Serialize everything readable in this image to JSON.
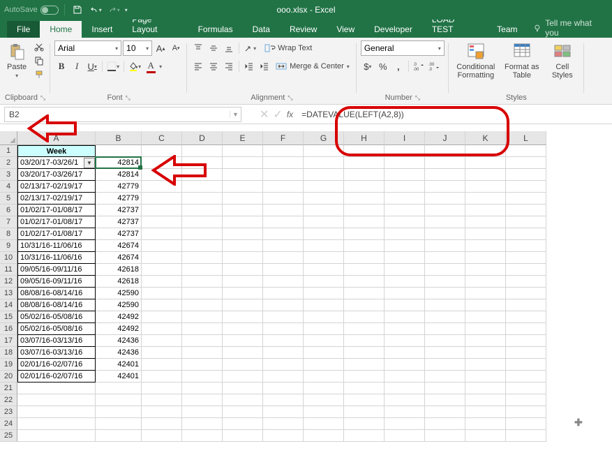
{
  "title": "ooo.xlsx - Excel",
  "autosave_label": "AutoSave",
  "toggle_state": "Off",
  "tabs": {
    "file": "File",
    "home": "Home",
    "insert": "Insert",
    "page_layout": "Page Layout",
    "formulas": "Formulas",
    "data": "Data",
    "review": "Review",
    "view": "View",
    "developer": "Developer",
    "load_test": "LOAD TEST",
    "team": "Team"
  },
  "tellme": "Tell me what you",
  "ribbon": {
    "clipboard": {
      "label": "Clipboard",
      "paste": "Paste"
    },
    "font": {
      "label": "Font",
      "name": "Arial",
      "size": "10",
      "bold": "B",
      "italic": "I",
      "underline": "U",
      "color_letter": "A",
      "size_up": "A",
      "size_down": "A"
    },
    "alignment": {
      "label": "Alignment",
      "wrap": "Wrap Text",
      "merge": "Merge & Center"
    },
    "number": {
      "label": "Number",
      "format": "General",
      "currency": "$",
      "percent": "%",
      "comma": ","
    },
    "styles": {
      "label": "Styles",
      "conditional": "Conditional Formatting",
      "table": "Format as Table",
      "cell_styles": "Cell Styles"
    }
  },
  "namebox": "B2",
  "formula": "=DATEVALUE(LEFT(A2,8))",
  "fx": "fx",
  "col_headers": [
    "A",
    "B",
    "C",
    "D",
    "E",
    "F",
    "G",
    "H",
    "I",
    "J",
    "K",
    "L"
  ],
  "header_cell": "Week",
  "data_rows": [
    {
      "n": "2",
      "a": "03/20/17-03/26/1",
      "b": "42814"
    },
    {
      "n": "3",
      "a": "03/20/17-03/26/17",
      "b": "42814"
    },
    {
      "n": "4",
      "a": "02/13/17-02/19/17",
      "b": "42779"
    },
    {
      "n": "5",
      "a": "02/13/17-02/19/17",
      "b": "42779"
    },
    {
      "n": "6",
      "a": "01/02/17-01/08/17",
      "b": "42737"
    },
    {
      "n": "7",
      "a": "01/02/17-01/08/17",
      "b": "42737"
    },
    {
      "n": "8",
      "a": "01/02/17-01/08/17",
      "b": "42737"
    },
    {
      "n": "9",
      "a": "10/31/16-11/06/16",
      "b": "42674"
    },
    {
      "n": "10",
      "a": "10/31/16-11/06/16",
      "b": "42674"
    },
    {
      "n": "11",
      "a": "09/05/16-09/11/16",
      "b": "42618"
    },
    {
      "n": "12",
      "a": "09/05/16-09/11/16",
      "b": "42618"
    },
    {
      "n": "13",
      "a": "08/08/16-08/14/16",
      "b": "42590"
    },
    {
      "n": "14",
      "a": "08/08/16-08/14/16",
      "b": "42590"
    },
    {
      "n": "15",
      "a": "05/02/16-05/08/16",
      "b": "42492"
    },
    {
      "n": "16",
      "a": "05/02/16-05/08/16",
      "b": "42492"
    },
    {
      "n": "17",
      "a": "03/07/16-03/13/16",
      "b": "42436"
    },
    {
      "n": "18",
      "a": "03/07/16-03/13/16",
      "b": "42436"
    },
    {
      "n": "19",
      "a": "02/01/16-02/07/16",
      "b": "42401"
    },
    {
      "n": "20",
      "a": "02/01/16-02/07/16",
      "b": "42401"
    }
  ],
  "empty_rows": [
    "21",
    "22",
    "23",
    "24",
    "25"
  ]
}
